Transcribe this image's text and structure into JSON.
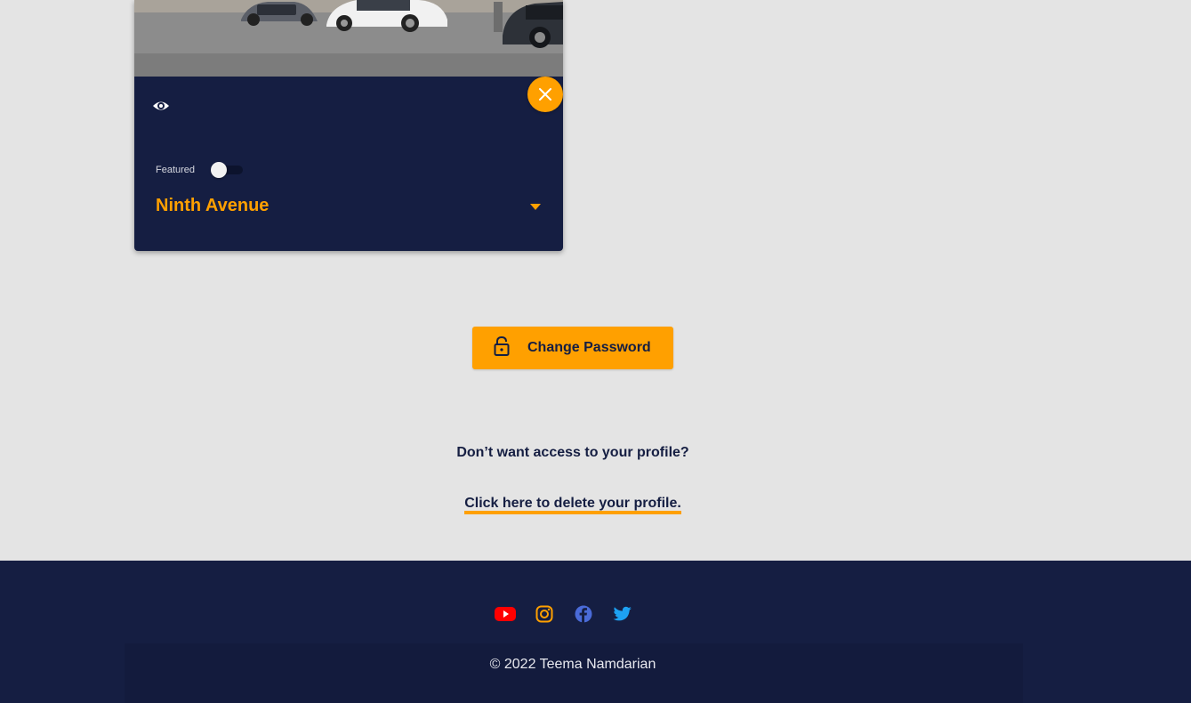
{
  "card": {
    "title": "Ninth Avenue",
    "featured_label": "Featured",
    "featured_enabled": false,
    "image": "street-with-parked-cars-photo",
    "icons": {
      "view": "eye-icon",
      "close": "close-icon",
      "expand": "caret-down-icon"
    }
  },
  "actions": {
    "change_password_label": "Change Password",
    "change_password_icon": "lock-icon"
  },
  "delete_section": {
    "question": "Don’t want access to your profile?",
    "link_label": "Click here to delete your profile."
  },
  "footer": {
    "social_icons": [
      "youtube-icon",
      "instagram-icon",
      "facebook-icon",
      "twitter-icon"
    ],
    "copyright": "© 2022 Teema Namdarian"
  },
  "colors": {
    "accent": "#ffa000",
    "navy": "#151e42",
    "background": "#e4e4e4",
    "youtube": "#ff0000",
    "instagram": "#ffa000",
    "facebook": "#4a6bd8",
    "twitter": "#1da1f2"
  }
}
